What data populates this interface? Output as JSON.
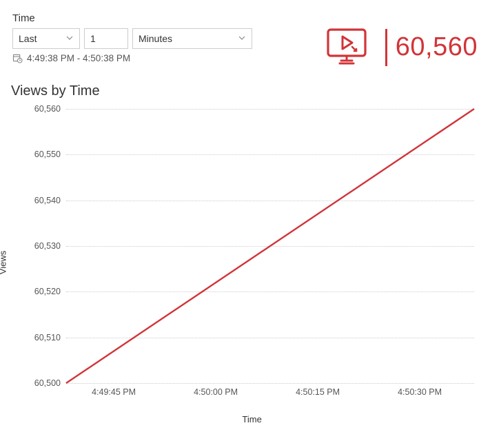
{
  "time_section": {
    "label": "Time",
    "range_mode": "Last",
    "count": "1",
    "unit": "Minutes",
    "range_text": "4:49:38 PM - 4:50:38 PM"
  },
  "metric": {
    "value": "60,560"
  },
  "chart_data": {
    "type": "line",
    "title": "Views by Time",
    "xlabel": "Time",
    "ylabel": "Views",
    "ylim": [
      60500,
      60560
    ],
    "y_ticks": [
      "60,500",
      "60,510",
      "60,520",
      "60,530",
      "60,540",
      "60,550",
      "60,560"
    ],
    "x_ticks": [
      "4:49:45 PM",
      "4:50:00 PM",
      "4:50:15 PM",
      "4:50:30 PM"
    ],
    "x_range_seconds": [
      0,
      60
    ],
    "x_tick_seconds": [
      7,
      22,
      37,
      52
    ],
    "series": [
      {
        "name": "Views",
        "x": [
          0,
          60
        ],
        "y": [
          60500,
          60560
        ]
      }
    ]
  }
}
